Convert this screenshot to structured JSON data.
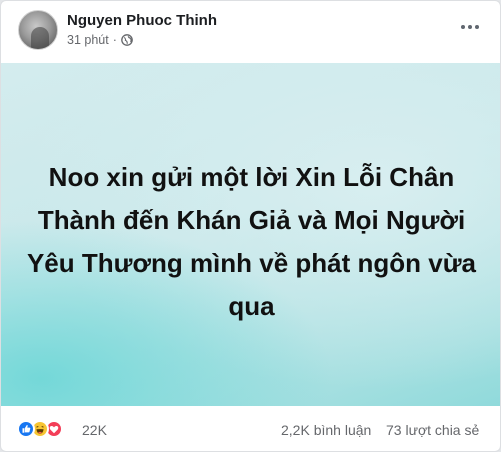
{
  "post": {
    "author": "Nguyen Phuoc Thinh",
    "time": "31 phút",
    "separator": "·",
    "privacy_icon": "globe-icon",
    "more_icon": "more-horizontal-icon",
    "body_text": "Noo xin gửi một lời Xin Lỗi Chân Thành đến Khán Giả và Mọi Người Yêu Thương mình về phát ngôn vừa qua",
    "background_colors": [
      "#d4ecee",
      "#90dadb"
    ]
  },
  "footer": {
    "reactions": [
      "like",
      "haha",
      "love"
    ],
    "reaction_count": "22K",
    "comments": "2,2K bình luận",
    "shares": "73 lượt chia sẻ"
  }
}
